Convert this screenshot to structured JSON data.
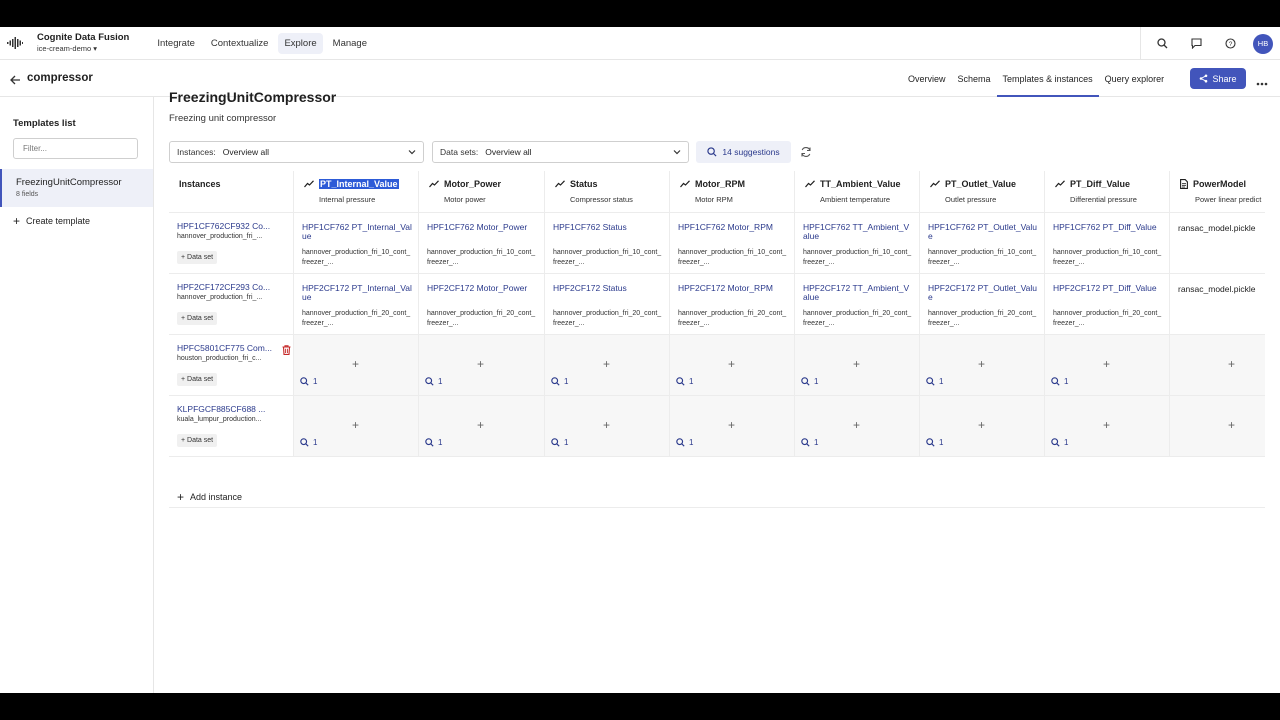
{
  "app": {
    "title": "Cognite Data Fusion",
    "project": "ice-cream-demo",
    "nav": [
      "Integrate",
      "Contextualize",
      "Explore",
      "Manage"
    ],
    "active_nav": "Explore",
    "avatar": "HB"
  },
  "subheader": {
    "crumb": "compressor",
    "tabs": [
      "Overview",
      "Schema",
      "Templates & instances",
      "Query explorer"
    ],
    "active_tab": "Templates & instances",
    "share_label": "Share"
  },
  "sidebar": {
    "title": "Templates list",
    "filter_placeholder": "Filter...",
    "item_name": "FreezingUnitCompressor",
    "item_sub": "8 fields",
    "create_label": "Create template"
  },
  "main": {
    "title": "FreezingUnitCompressor",
    "subtitle": "Freezing unit compressor",
    "instances_label": "Instances:",
    "instances_value": "Overview all",
    "datasets_label": "Data sets:",
    "datasets_value": "Overview all",
    "suggestions": "14 suggestions",
    "instances_header": "Instances",
    "add_instance": "Add instance",
    "dataset_btn": "+ Data set"
  },
  "columns": [
    {
      "name": "PT_Internal_Value",
      "desc": "Internal pressure",
      "icon": "timeseries"
    },
    {
      "name": "Motor_Power",
      "desc": "Motor power",
      "icon": "timeseries"
    },
    {
      "name": "Status",
      "desc": "Compressor status",
      "icon": "timeseries"
    },
    {
      "name": "Motor_RPM",
      "desc": "Motor RPM",
      "icon": "timeseries"
    },
    {
      "name": "TT_Ambient_Value",
      "desc": "Ambient temperature",
      "icon": "timeseries"
    },
    {
      "name": "PT_Outlet_Value",
      "desc": "Outlet pressure",
      "icon": "timeseries"
    },
    {
      "name": "PT_Diff_Value",
      "desc": "Differential pressure",
      "icon": "timeseries"
    },
    {
      "name": "PowerModel",
      "desc": "Power linear predict",
      "icon": "document"
    }
  ],
  "rows": [
    {
      "name": "HPF1CF762CF932 Co...",
      "sub": "hannover_production_fri_...",
      "cells": [
        {
          "link": "HPF1CF762 PT_Internal_Value",
          "sub": "hannover_production_fri_10_cont_freezer_..."
        },
        {
          "link": "HPF1CF762 Motor_Power",
          "sub": "hannover_production_fri_10_cont_freezer_..."
        },
        {
          "link": "HPF1CF762 Status",
          "sub": "hannover_production_fri_10_cont_freezer_..."
        },
        {
          "link": "HPF1CF762 Motor_RPM",
          "sub": "hannover_production_fri_10_cont_freezer_..."
        },
        {
          "link": "HPF1CF762 TT_Ambient_Value",
          "sub": "hannover_production_fri_10_cont_freezer_..."
        },
        {
          "link": "HPF1CF762 PT_Outlet_Value",
          "sub": "hannover_production_fri_10_cont_freezer_..."
        },
        {
          "link": "HPF1CF762 PT_Diff_Value",
          "sub": "hannover_production_fri_10_cont_freezer_..."
        },
        {
          "plain": "ransac_model.pickle"
        }
      ]
    },
    {
      "name": "HPF2CF172CF293 Co...",
      "sub": "hannover_production_fri_...",
      "cells": [
        {
          "link": "HPF2CF172 PT_Internal_Value",
          "sub": "hannover_production_fri_20_cont_freezer_..."
        },
        {
          "link": "HPF2CF172 Motor_Power",
          "sub": "hannover_production_fri_20_cont_freezer_..."
        },
        {
          "link": "HPF2CF172 Status",
          "sub": "hannover_production_fri_20_cont_freezer_..."
        },
        {
          "link": "HPF2CF172 Motor_RPM",
          "sub": "hannover_production_fri_20_cont_freezer_..."
        },
        {
          "link": "HPF2CF172 TT_Ambient_Value",
          "sub": "hannover_production_fri_20_cont_freezer_..."
        },
        {
          "link": "HPF2CF172 PT_Outlet_Value",
          "sub": "hannover_production_fri_20_cont_freezer_..."
        },
        {
          "link": "HPF2CF172 PT_Diff_Value",
          "sub": "hannover_production_fri_20_cont_freezer_..."
        },
        {
          "plain": "ransac_model.pickle"
        }
      ]
    },
    {
      "name": "HPFC5801CF775 Com...",
      "sub": "houston_production_fri_c...",
      "trash": true,
      "cells": [
        {
          "count": "1"
        },
        {
          "count": "1"
        },
        {
          "count": "1"
        },
        {
          "count": "1"
        },
        {
          "count": "1"
        },
        {
          "count": "1"
        },
        {
          "count": "1"
        },
        {
          "count": ""
        }
      ]
    },
    {
      "name": "KLPFGCF885CF688 ...",
      "sub": "kuala_lumpur_production...",
      "cells": [
        {
          "count": "1"
        },
        {
          "count": "1"
        },
        {
          "count": "1"
        },
        {
          "count": "1"
        },
        {
          "count": "1"
        },
        {
          "count": "1"
        },
        {
          "count": "1"
        },
        {
          "count": ""
        }
      ]
    }
  ],
  "colors": {
    "accent": "#4255bb",
    "link": "#2b3a8c",
    "selection": "#2d5bd7"
  }
}
